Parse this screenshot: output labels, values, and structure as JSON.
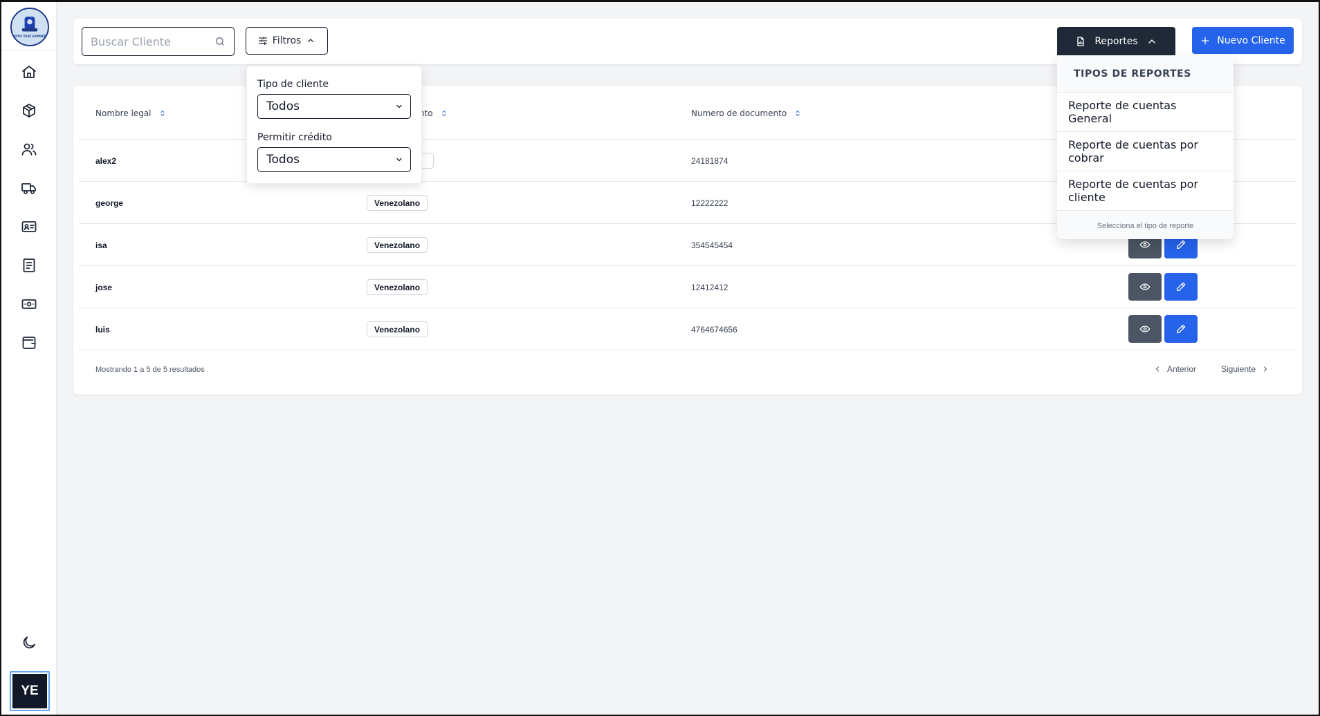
{
  "sidebar": {
    "logo_text": "MOTO TEXI EXPRESS",
    "nav": [
      "home-icon",
      "package-icon",
      "users-icon",
      "truck-icon",
      "id-card-icon",
      "document-icon",
      "cash-icon",
      "wallet-icon"
    ],
    "theme_toggle": "moon-icon",
    "avatar_initials": "YE"
  },
  "toolbar": {
    "search_placeholder": "Buscar Cliente",
    "filters_label": "Filtros",
    "reports_label": "Reportes",
    "new_client_label": "Nuevo Cliente"
  },
  "filters": {
    "client_type_label": "Tipo de cliente",
    "client_type_value": "Todos",
    "credit_label": "Permitir crédito",
    "credit_value": "Todos"
  },
  "reports_menu": {
    "header": "TIPOS DE REPORTES",
    "items": [
      "Reporte de cuentas General",
      "Reporte de cuentas por cobrar",
      "Reporte de cuentas por cliente"
    ],
    "footer": "Selecciona el tipo de reporte"
  },
  "table": {
    "columns": [
      "Nombre legal",
      "nto",
      "Numero de documento"
    ],
    "rows": [
      {
        "name": "alex2",
        "type": "",
        "document": "24181874"
      },
      {
        "name": "george",
        "type": "Venezolano",
        "document": "12222222"
      },
      {
        "name": "isa",
        "type": "Venezolano",
        "document": "354545454"
      },
      {
        "name": "jose",
        "type": "Venezolano",
        "document": "12412412"
      },
      {
        "name": "luis",
        "type": "Venezolano",
        "document": "4764674656"
      }
    ],
    "footer_text": "Mostrando 1 a 5 de 5 resultados",
    "prev_label": "Anterior",
    "next_label": "Siguiente"
  },
  "colors": {
    "primary": "#2563eb",
    "dark": "#1f2937",
    "view_button": "#4b5563",
    "background": "#f3f4f6"
  }
}
